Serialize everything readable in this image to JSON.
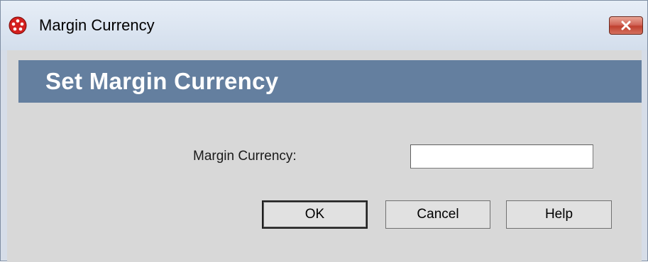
{
  "window": {
    "title": "Margin Currency",
    "app_icon": "app-logo-icon",
    "close_icon": "close-icon",
    "close_button_color": "#c9503f"
  },
  "banner": {
    "title": "Set Margin Currency",
    "background_color": "#647f9f"
  },
  "form": {
    "margin_currency_label": "Margin Currency:",
    "margin_currency_value": "",
    "margin_currency_placeholder": ""
  },
  "buttons": {
    "ok_label": "OK",
    "cancel_label": "Cancel",
    "help_label": "Help"
  }
}
